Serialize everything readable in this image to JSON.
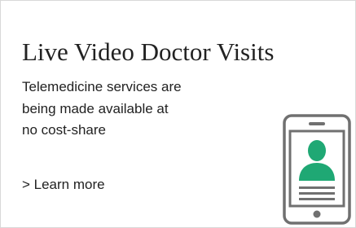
{
  "card": {
    "title": "Live Video Doctor Visits",
    "description": "Telemedicine services are being made available at no cost-share",
    "link_label": "> Learn more"
  },
  "icon": {
    "name": "telemedicine-phone-icon",
    "accent_color": "#1fa874",
    "device_color": "#707070"
  }
}
